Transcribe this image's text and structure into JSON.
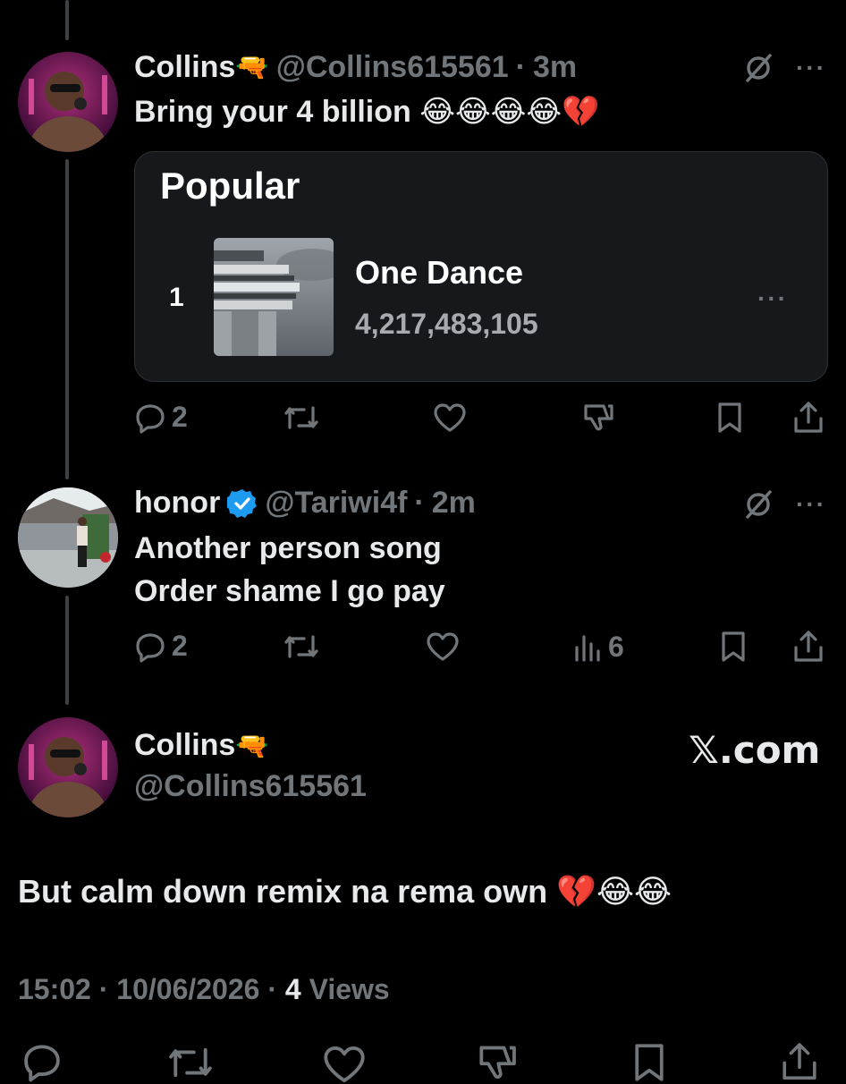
{
  "tweet1": {
    "name": "Collins",
    "name_emoji": "🔫",
    "handle": "@Collins615561",
    "time": "3m",
    "text": "Bring your 4 billion 😂😂😂😂💔",
    "card": {
      "title": "Popular",
      "rank": "1",
      "song": "One Dance",
      "plays": "4,217,483,105"
    },
    "replies": "2"
  },
  "tweet2": {
    "name": "honor",
    "handle": "@Tariwi4f",
    "time": "2m",
    "text_line1": "Another person song",
    "text_line2": "Order shame I go pay",
    "replies": "2",
    "views": "6"
  },
  "main": {
    "name": "Collins",
    "name_emoji": "🔫",
    "handle": "@Collins615561",
    "watermark": "𝕏.com",
    "text": "But calm down remix na rema own 💔😂😂",
    "time": "15:02",
    "date": "10/06/2026",
    "views_count": "4",
    "views_label": "Views"
  },
  "colors": {
    "background": "#000000",
    "text": "#e7e9ea",
    "muted": "#71767b",
    "card": "#16181c",
    "verified": "#1d9bf0"
  }
}
